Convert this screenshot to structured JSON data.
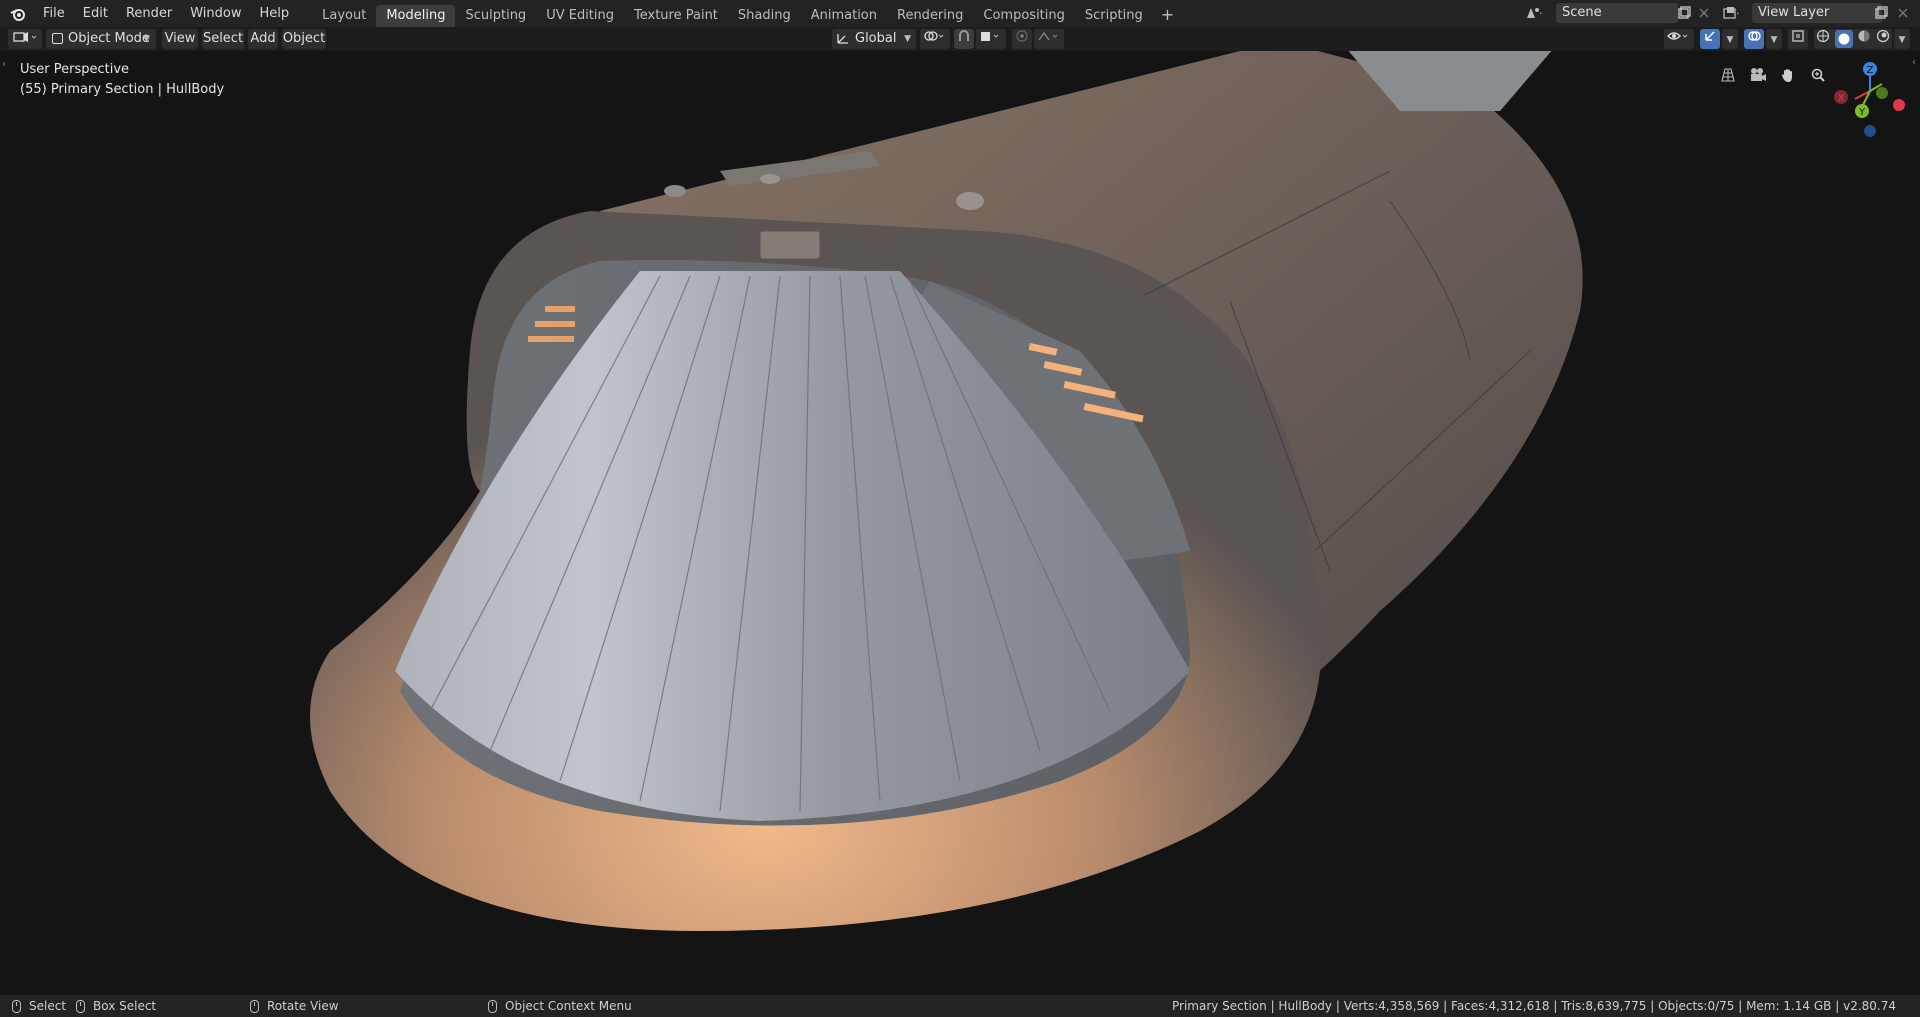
{
  "topbar": {
    "menus": [
      "File",
      "Edit",
      "Render",
      "Window",
      "Help"
    ],
    "workspaces": [
      "Layout",
      "Modeling",
      "Sculpting",
      "UV Editing",
      "Texture Paint",
      "Shading",
      "Animation",
      "Rendering",
      "Compositing",
      "Scripting"
    ],
    "active_workspace": "Modeling",
    "add_workspace": "+",
    "scene": "Scene",
    "view_layer": "View Layer"
  },
  "header": {
    "mode": "Object Mode",
    "menus": [
      "View",
      "Select",
      "Add",
      "Object"
    ],
    "transform_orientation": "Global"
  },
  "viewport": {
    "perspective_label": "User Perspective",
    "object_label": "(55) Primary Section | HullBody",
    "gizmo_axes": {
      "x": "X",
      "y": "Y",
      "z": "Z"
    }
  },
  "statusbar": {
    "select": "Select",
    "box_select": "Box Select",
    "rotate_view": "Rotate View",
    "context_menu": "Object Context Menu",
    "stats": "Primary Section | HullBody | Verts:4,358,569 | Faces:4,312,618 | Tris:8,639,775 | Objects:0/75 | Mem: 1.14 GB | v2.80.74"
  },
  "colors": {
    "accent": "#4772b3",
    "axis_x": "#e0394a",
    "axis_y": "#7dbb24",
    "axis_z": "#3b84e6"
  }
}
